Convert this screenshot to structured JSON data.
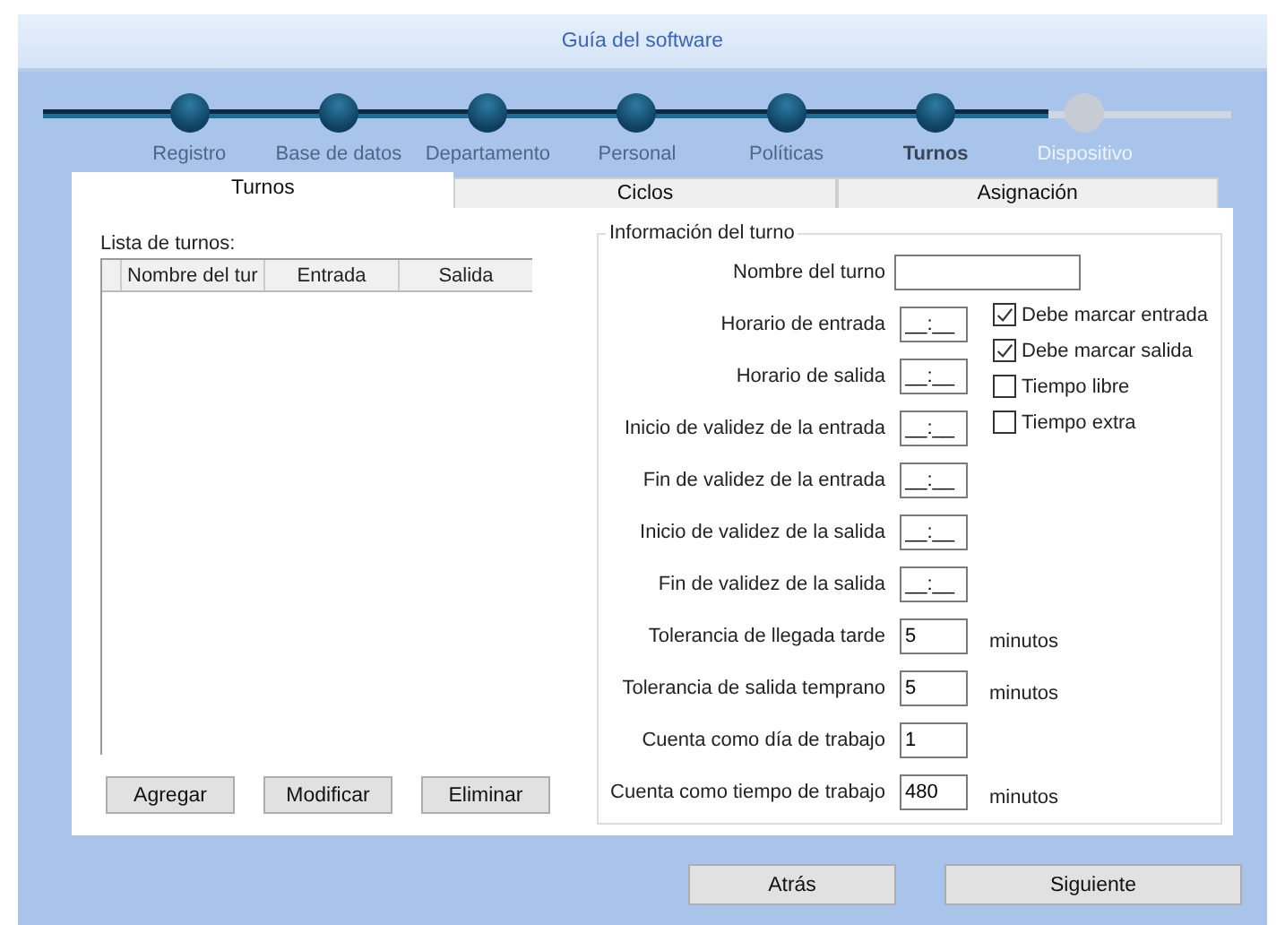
{
  "window": {
    "title": "Guía del software"
  },
  "steps": [
    {
      "label": "Registro",
      "done": true,
      "selected": false
    },
    {
      "label": "Base de datos",
      "done": true,
      "selected": false
    },
    {
      "label": "Departamento",
      "done": true,
      "selected": false
    },
    {
      "label": "Personal",
      "done": true,
      "selected": false
    },
    {
      "label": "Políticas",
      "done": true,
      "selected": false
    },
    {
      "label": "Turnos",
      "done": true,
      "selected": true
    },
    {
      "label": "Dispositivo",
      "done": false,
      "selected": false
    }
  ],
  "tabs": [
    {
      "label": "Turnos",
      "selected": true
    },
    {
      "label": "Ciclos",
      "selected": false
    },
    {
      "label": "Asignación",
      "selected": false
    }
  ],
  "shift_list": {
    "label": "Lista de turnos:",
    "columns": [
      "Nombre del tur",
      "Entrada",
      "Salida"
    ],
    "buttons": [
      "Agregar",
      "Modificar",
      "Eliminar"
    ]
  },
  "shift_info": {
    "title": "Información del turno",
    "fields": [
      {
        "label": "Nombre del turno",
        "kind": "text"
      },
      {
        "label": "Horario de entrada",
        "value": "__:__",
        "kind": "time"
      },
      {
        "label": "Horario de salida",
        "value": "__:__",
        "kind": "time"
      },
      {
        "label": "Inicio de validez de la entrada",
        "value": "__:__",
        "kind": "time"
      },
      {
        "label": "Fin de validez de la entrada",
        "value": "__:__",
        "kind": "time"
      },
      {
        "label": "Inicio de validez de la salida",
        "value": "__:__",
        "kind": "time"
      },
      {
        "label": "Fin de validez de la salida",
        "value": "__:__",
        "kind": "time"
      },
      {
        "label": "Tolerancia de llegada tarde",
        "value": "5",
        "kind": "number",
        "unit": "minutos"
      },
      {
        "label": "Tolerancia de salida temprano",
        "value": "5",
        "kind": "number",
        "unit": "minutos"
      },
      {
        "label": "Cuenta como día de trabajo",
        "value": "1",
        "kind": "number"
      },
      {
        "label": "Cuenta como tiempo de trabajo",
        "value": "480",
        "kind": "number",
        "unit": "minutos"
      }
    ],
    "checkboxes": [
      {
        "label": "Debe marcar entrada",
        "checked": true
      },
      {
        "label": "Debe marcar salida",
        "checked": true
      },
      {
        "label": "Tiempo libre",
        "checked": false
      },
      {
        "label": "Tiempo extra",
        "checked": false
      }
    ]
  },
  "buttons": [
    "Atrás",
    "Siguiente"
  ]
}
